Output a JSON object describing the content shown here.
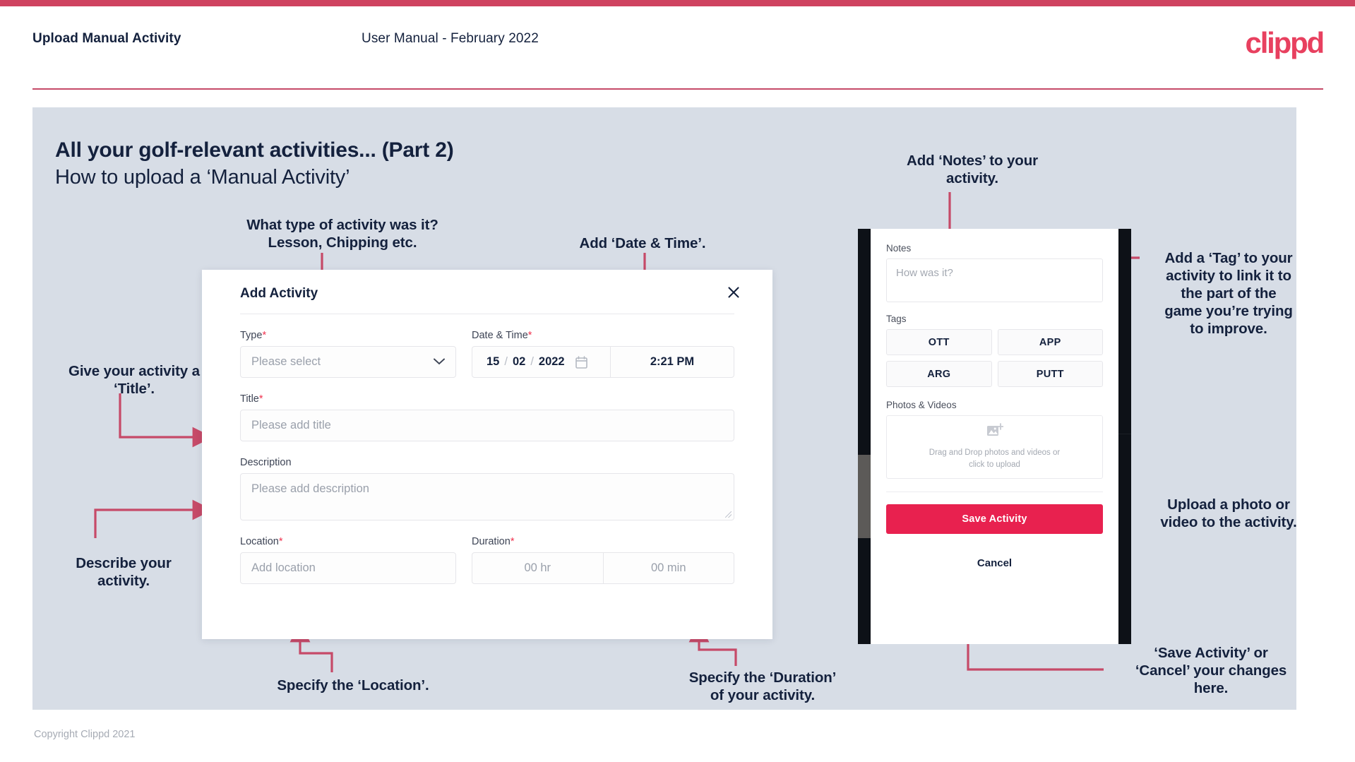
{
  "theme": {
    "accent": "#e8214f",
    "bar": "#cf4360",
    "panel_bg": "#d7dde6",
    "text": "#14213d",
    "arrow": "#c64a68"
  },
  "header": {
    "title": "Upload Manual Activity",
    "subtitle": "User Manual - February 2022",
    "logo": "clippd"
  },
  "slide": {
    "title": "All your golf-relevant activities... (Part 2)",
    "subtitle": "How to upload a ‘Manual Activity’"
  },
  "annotations": {
    "type": "What type of activity was it?\nLesson, Chipping etc.",
    "type_l1": "What type of activity was it?",
    "type_l2": "Lesson, Chipping etc.",
    "datetime": "Add ‘Date & Time’.",
    "title_l1": "Give your activity a",
    "title_l2": "‘Title’.",
    "describe_l1": "Describe your",
    "describe_l2": "activity.",
    "location": "Specify the ‘Location’.",
    "duration_l1": "Specify the ‘Duration’",
    "duration_l2": "of your activity.",
    "notes_l1": "Add ‘Notes’ to your",
    "notes_l2": "activity.",
    "tag_l1": "Add a ‘Tag’ to your",
    "tag_l2": "activity to link it to",
    "tag_l3": "the part of the",
    "tag_l4": "game you’re trying",
    "tag_l5": "to improve.",
    "upload_l1": "Upload a photo or",
    "upload_l2": "video to the activity.",
    "save_l1": "‘Save Activity’ or",
    "save_l2": "‘Cancel’ your changes",
    "save_l3": "here."
  },
  "dialog": {
    "title": "Add Activity",
    "close_icon": "close-icon",
    "fields": {
      "type": {
        "label": "Type",
        "required": "*",
        "placeholder": "Please select",
        "caret_icon": "chevron-down-icon"
      },
      "datetime": {
        "label": "Date & Time",
        "required": "*",
        "day": "15",
        "month": "02",
        "year": "2022",
        "sep": "/",
        "calendar_icon": "calendar-icon",
        "time": "2:21 PM"
      },
      "title": {
        "label": "Title",
        "required": "*",
        "placeholder": "Please add title"
      },
      "description": {
        "label": "Description",
        "required": "",
        "placeholder": "Please add description"
      },
      "location": {
        "label": "Location",
        "required": "*",
        "placeholder": "Add location"
      },
      "duration": {
        "label": "Duration",
        "required": "*",
        "hours_placeholder": "00 hr",
        "minutes_placeholder": "00 min"
      }
    }
  },
  "phone": {
    "notes": {
      "label": "Notes",
      "placeholder": "How was it?"
    },
    "tags": {
      "label": "Tags",
      "items": [
        "OTT",
        "APP",
        "ARG",
        "PUTT"
      ]
    },
    "photos": {
      "label": "Photos & Videos",
      "upload_icon": "add-image-icon",
      "drop_line1": "Drag and Drop photos and videos or",
      "drop_line2": "click to upload"
    },
    "save_label": "Save Activity",
    "cancel_label": "Cancel"
  },
  "footer": {
    "copyright": "Copyright Clippd 2021"
  }
}
